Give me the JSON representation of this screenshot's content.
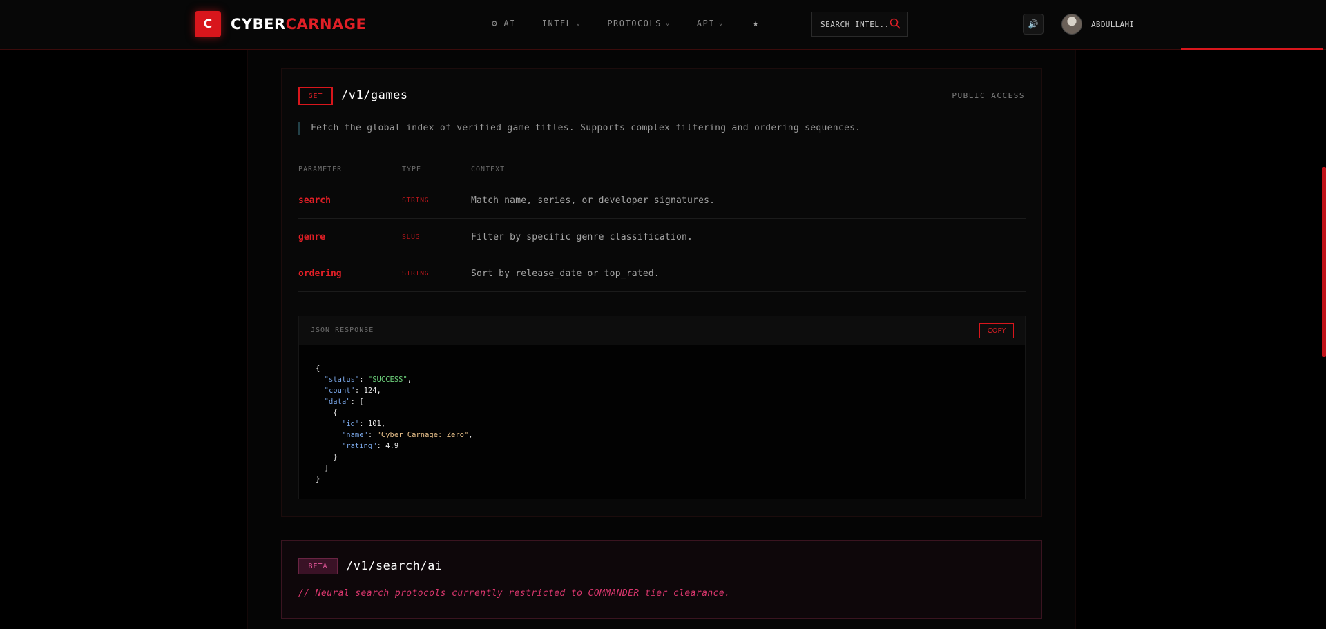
{
  "brand": {
    "logo_letter": "C",
    "name_part1": "CYBER",
    "name_part2": "CARNAGE"
  },
  "nav": {
    "ai_icon": "robot-icon",
    "ai_label": "AI",
    "intel_label": "INTEL",
    "protocols_label": "PROTOCOLS",
    "api_label": "API",
    "chevron_icon": "chevron-down-icon",
    "star_icon": "star-icon"
  },
  "search": {
    "placeholder": "SEARCH INTEL...",
    "icon": "search-icon"
  },
  "user": {
    "sound_icon": "speaker-icon",
    "name": "ABDULLAHI"
  },
  "endpoint_games": {
    "method": "GET",
    "path": "/v1/games",
    "access": "PUBLIC ACCESS",
    "description": "Fetch the global index of verified game titles. Supports complex filtering and ordering sequences.",
    "columns": [
      "PARAMETER",
      "TYPE",
      "CONTEXT"
    ],
    "params": [
      {
        "name": "search",
        "type": "STRING",
        "context": "Match name, series, or developer signatures."
      },
      {
        "name": "genre",
        "type": "SLUG",
        "context": "Filter by specific genre classification."
      },
      {
        "name": "ordering",
        "type": "STRING",
        "context": "Sort by release_date or top_rated."
      }
    ],
    "response": {
      "title": "JSON RESPONSE",
      "copy_label": "COPY",
      "status": "\"SUCCESS\"",
      "count": "124",
      "id": "101",
      "name": "\"Cyber Carnage: Zero\"",
      "rating": "4.9"
    }
  },
  "endpoint_ai": {
    "badge": "BETA",
    "path": "/v1/search/ai",
    "note": "// Neural search protocols currently restricted to COMMANDER tier clearance."
  },
  "colors": {
    "accent": "#d8161c",
    "beta": "#e05598",
    "background": "#000000"
  }
}
